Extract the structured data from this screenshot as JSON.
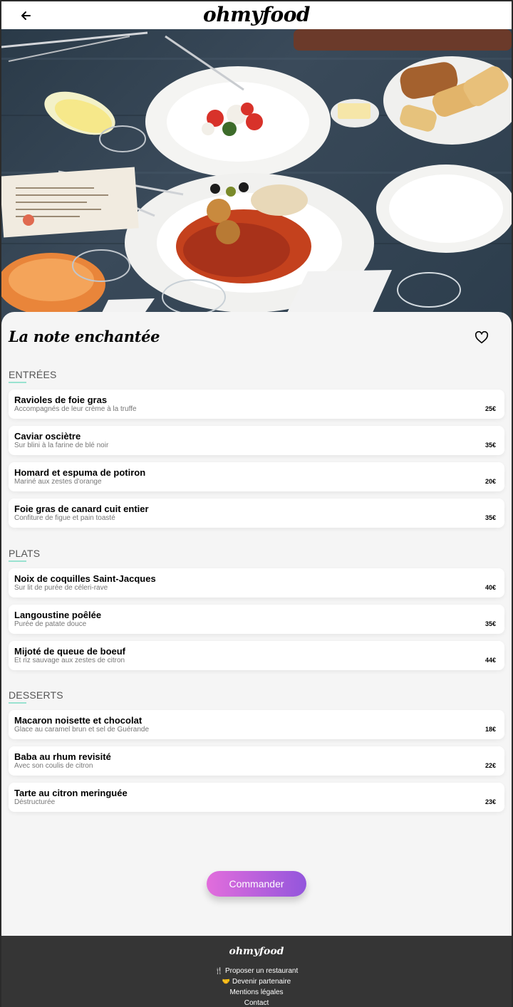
{
  "header": {
    "back_icon": "arrow-left-icon",
    "logo": "ohmyfood"
  },
  "restaurant": {
    "name": "La note enchantée",
    "favorite_icon": "heart-outline-icon"
  },
  "menu": {
    "sections": [
      {
        "title": "ENTRÉES",
        "dishes": [
          {
            "name": "Ravioles de foie gras",
            "desc": "Accompagnés de leur crème à la truffe",
            "price": "25€"
          },
          {
            "name": "Caviar osciètre",
            "desc": "Sur blini à la farine de blé noir",
            "price": "35€"
          },
          {
            "name": "Homard et espuma de potiron",
            "desc": "Mariné aux zestes d'orange",
            "price": "20€"
          },
          {
            "name": "Foie gras de canard cuit entier",
            "desc": "Confiture de figue et pain toasté",
            "price": "35€"
          }
        ]
      },
      {
        "title": "PLATS",
        "dishes": [
          {
            "name": "Noix de coquilles Saint-Jacques",
            "desc": "Sur lit de purée de céleri-rave",
            "price": "40€"
          },
          {
            "name": "Langoustine poêlée",
            "desc": "Purée de patate douce",
            "price": "35€"
          },
          {
            "name": "Mijoté de queue de boeuf",
            "desc": "Et riz sauvage aux zestes de citron",
            "price": "44€"
          }
        ]
      },
      {
        "title": "DESSERTS",
        "dishes": [
          {
            "name": "Macaron noisette et chocolat",
            "desc": "Glace au caramel brun et sel de Guérande",
            "price": "18€"
          },
          {
            "name": "Baba au rhum revisité",
            "desc": "Avec son coulis de citron",
            "price": "22€"
          },
          {
            "name": "Tarte au citron meringuée",
            "desc": "Déstructurée",
            "price": "23€"
          }
        ]
      }
    ]
  },
  "order_button": "Commander",
  "footer": {
    "logo": "ohmyfood",
    "links": [
      {
        "icon": "utensils-icon",
        "label": "Proposer un restaurant"
      },
      {
        "icon": "handshake-icon",
        "label": "Devenir partenaire"
      },
      {
        "icon": "",
        "label": "Mentions légales"
      },
      {
        "icon": "",
        "label": "Contact"
      }
    ]
  },
  "colors": {
    "accent_underline": "#99e2d0",
    "button_start": "#e26ddc",
    "button_end": "#9356dc",
    "footer_bg": "#353535"
  }
}
